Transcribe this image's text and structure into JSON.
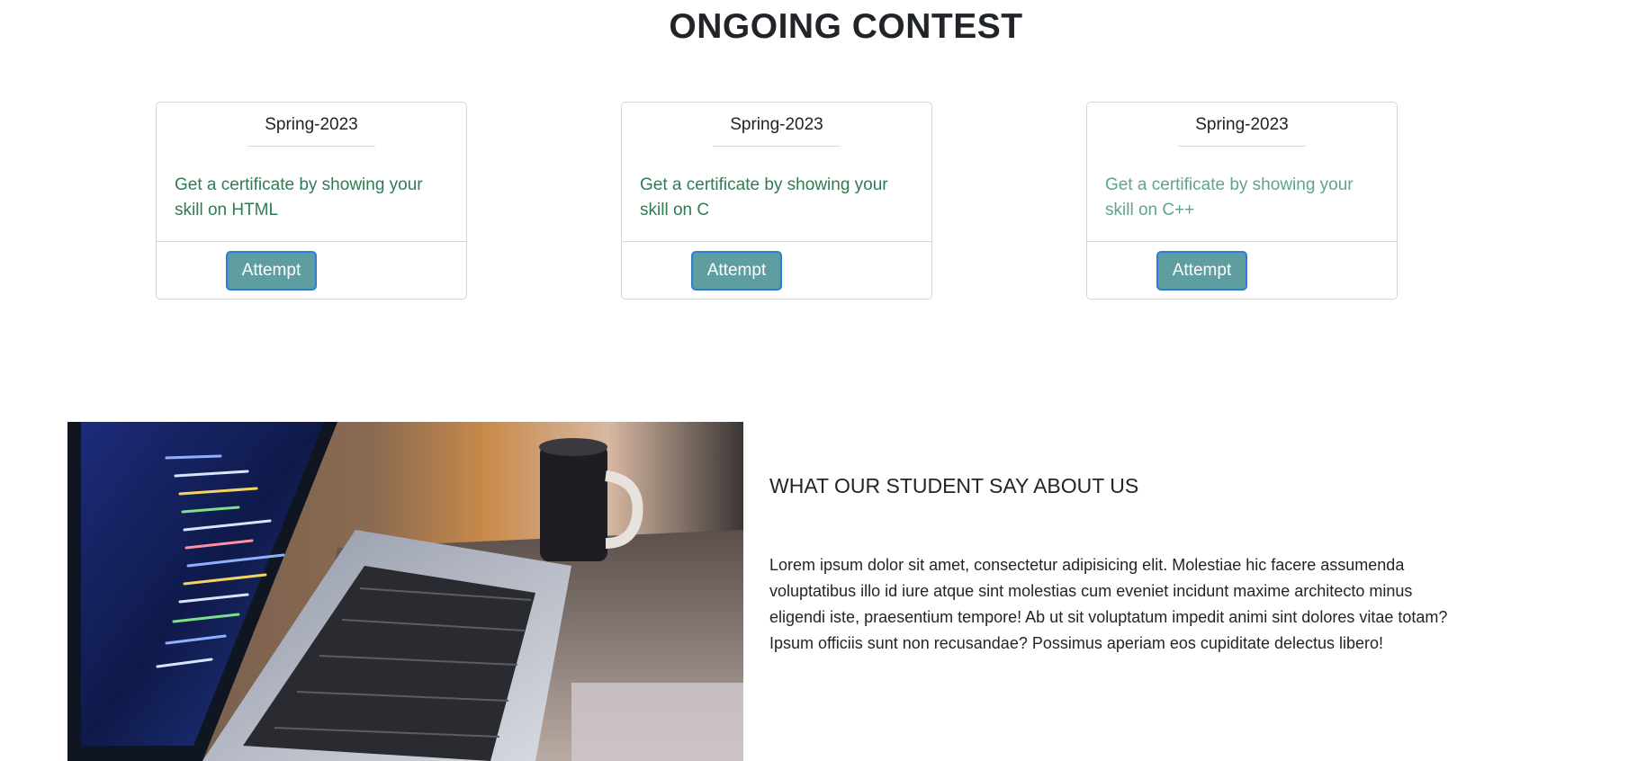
{
  "contest": {
    "title": "ONGOING CONTEST",
    "cards": [
      {
        "season": "Spring-2023",
        "description": "Get a certificate by showing your skill on HTML",
        "button": "Attempt"
      },
      {
        "season": "Spring-2023",
        "description": "Get a certificate by showing your skill on C",
        "button": "Attempt"
      },
      {
        "season": "Spring-2023",
        "description": "Get a certificate by showing your skill on C++",
        "button": "Attempt"
      }
    ]
  },
  "testimonial": {
    "heading": "WHAT OUR STUDENT SAY ABOUT US",
    "body": "Lorem ipsum dolor sit amet, consectetur adipisicing elit. Molestiae hic facere assumenda voluptatibus illo id iure atque sint molestias cum eveniet incidunt maxime architecto minus eligendi iste, praesentium tempore! Ab ut sit voluptatum impedit animi sint dolores vitae totam? Ipsum officiis sunt non recusandae? Possimus aperiam eos cupiditate delectus libero!"
  },
  "colors": {
    "description_text": "#2e7d52",
    "button_bg": "#5f9ea0",
    "button_border": "#2a7fd3"
  }
}
